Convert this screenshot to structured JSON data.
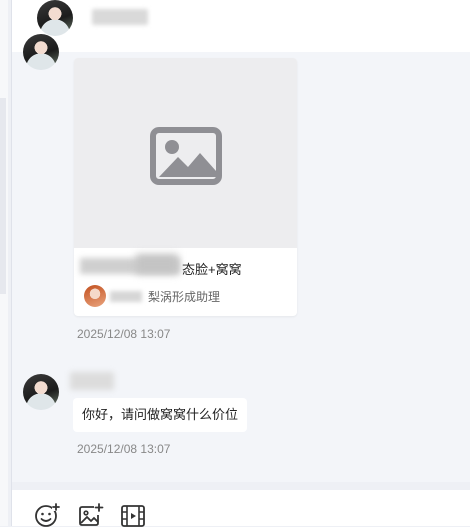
{
  "product_card": {
    "title_visible_suffix": "态脸+窝窝",
    "subtitle": "梨涡形成助理",
    "image_icon": "image-placeholder-icon"
  },
  "messages": [
    {
      "timestamp": "2025/12/08 13:07"
    },
    {
      "text": "你好，请问做窝窝什么价位",
      "timestamp": "2025/12/08 13:07"
    }
  ],
  "toolbar": {
    "icons": [
      "emoji-add-icon",
      "image-upload-icon",
      "video-icon"
    ]
  },
  "colors": {
    "chat_background": "#f3f5f9",
    "page_background": "#eef0f5",
    "bubble": "#ffffff",
    "timestamp": "#888888"
  }
}
